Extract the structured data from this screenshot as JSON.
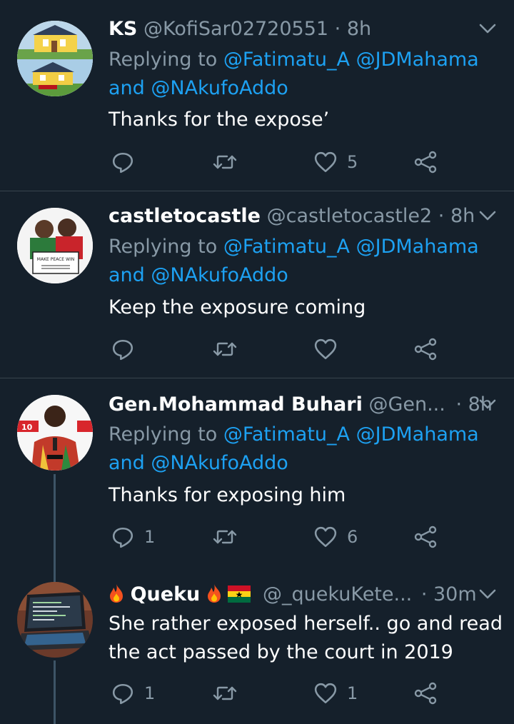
{
  "tweets": [
    {
      "name": "KS",
      "handle": "@KofiSar02720551",
      "time": "· 8h",
      "replying_prefix": "Replying to",
      "mention1": "@Fatimatu_A",
      "mention2": "@JDMahama",
      "and": "and",
      "mention3": "@NAkufoAddo",
      "text": "Thanks for the expose’",
      "reply_count": "",
      "retweet_count": "",
      "like_count": "5"
    },
    {
      "name": "castletocastle",
      "handle": "@castletocastle2",
      "time": "· 8h",
      "replying_prefix": "Replying to",
      "mention1": "@Fatimatu_A",
      "mention2": "@JDMahama",
      "and": "and",
      "mention3": "@NAkufoAddo",
      "text": "Keep the exposure coming",
      "reply_count": "",
      "retweet_count": "",
      "like_count": ""
    },
    {
      "name": "Gen.Mohammad Buhari",
      "handle": "@Gen...",
      "time": "· 8h",
      "replying_prefix": "Replying to",
      "mention1": "@Fatimatu_A",
      "mention2": "@JDMahama",
      "and": "and",
      "mention3": "@NAkufoAddo",
      "text": "Thanks for exposing him",
      "reply_count": "1",
      "retweet_count": "",
      "like_count": "6"
    },
    {
      "name": "Queku",
      "handle": "@_quekuKete...",
      "time": "· 30m",
      "text_line1": "She rather exposed herself.. go and read",
      "text_line2": "the act passed by the court in 2019",
      "reply_count": "1",
      "retweet_count": "",
      "like_count": "1"
    }
  ],
  "avatar3_banner": "10",
  "avatar2_sign": "MAKE PEACE WIN",
  "colors": {
    "background": "#15202b",
    "divider": "#38444d",
    "secondary_text": "#8899a6",
    "link": "#1da1f2"
  },
  "icons": [
    "chevron-down-icon",
    "reply-icon",
    "retweet-icon",
    "like-icon",
    "share-icon",
    "fire-emoji-icon",
    "ghana-flag-icon"
  ]
}
